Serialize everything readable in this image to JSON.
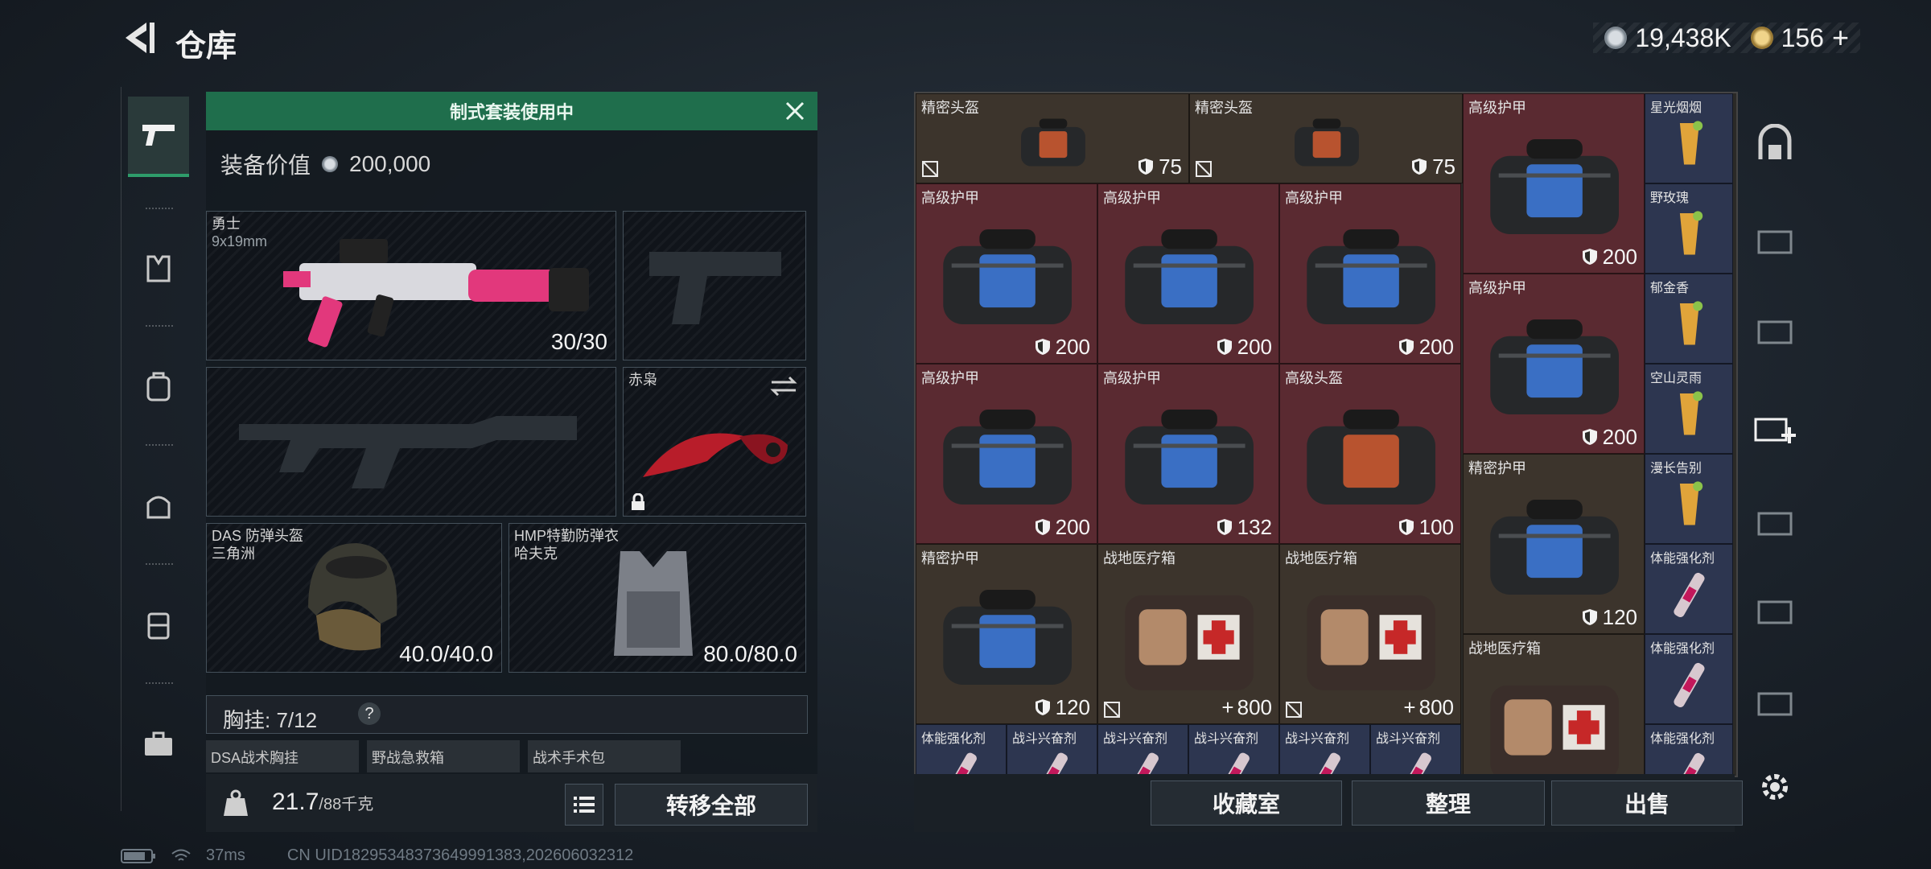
{
  "header": {
    "title": "仓库",
    "coins": "19,438K",
    "tokens": "156",
    "plus": "+"
  },
  "banner": {
    "text": "制式套装使用中"
  },
  "equip": {
    "value_label": "装备价值",
    "value": "200,000"
  },
  "slots": {
    "primary": {
      "name": "勇士",
      "caliber": "9x19mm",
      "count": "30/30"
    },
    "melee": {
      "name": "赤枭"
    },
    "helmet": {
      "name": "DAS 防弹头盔",
      "sub": "三角洲",
      "count": "40.0/40.0"
    },
    "armor": {
      "name": "HMP特勤防弹衣",
      "sub": "哈夫克",
      "count": "80.0/80.0"
    }
  },
  "chest": {
    "label": "胸挂: 7/12",
    "help": "?"
  },
  "chest_items": [
    "DSA战术胸挂",
    "野战急救箱",
    "战术手术包"
  ],
  "bottom": {
    "weight": "21.7",
    "weight_max": "/88千克",
    "transfer_all": "转移全部"
  },
  "grid": {
    "items": [
      {
        "name": "精密头盔",
        "value": "75"
      },
      {
        "name": "精密头盔",
        "value": "75"
      },
      {
        "name": "高级护甲",
        "value": "200"
      },
      {
        "name": "星光烟烟",
        "value": ""
      },
      {
        "name": "高级护甲",
        "value": "200"
      },
      {
        "name": "高级护甲",
        "value": "200"
      },
      {
        "name": "高级护甲",
        "value": "200"
      },
      {
        "name": "野玫瑰",
        "value": ""
      },
      {
        "name": "高级护甲",
        "value": "200"
      },
      {
        "name": "郁金香",
        "value": ""
      },
      {
        "name": "高级护甲",
        "value": "200"
      },
      {
        "name": "高级护甲",
        "value": "132"
      },
      {
        "name": "高级头盔",
        "value": "100"
      },
      {
        "name": "空山灵雨",
        "value": ""
      },
      {
        "name": "精密护甲",
        "value": "120"
      },
      {
        "name": "漫长告别",
        "value": ""
      },
      {
        "name": "精密护甲",
        "value": "120"
      },
      {
        "name": "战地医疗箱",
        "value": "800"
      },
      {
        "name": "战地医疗箱",
        "value": "800"
      },
      {
        "name": "体能强化剂",
        "value": ""
      },
      {
        "name": "战地医疗箱",
        "value": ""
      },
      {
        "name": "体能强化剂",
        "value": ""
      },
      {
        "name": "体能强化剂",
        "value": ""
      },
      {
        "name": "战斗兴奋剂",
        "value": ""
      },
      {
        "name": "战斗兴奋剂",
        "value": ""
      },
      {
        "name": "战斗兴奋剂",
        "value": ""
      },
      {
        "name": "战斗兴奋剂",
        "value": ""
      },
      {
        "name": "战斗兴奋剂",
        "value": ""
      },
      {
        "name": "体能强化剂",
        "value": ""
      }
    ],
    "plus": "+"
  },
  "actions": {
    "vault": "收藏室",
    "sort": "整理",
    "sell": "出售"
  },
  "status": {
    "ping": "37ms",
    "uid": "CN UID182953483736499913​83,202606032312"
  },
  "colors": {
    "accent": "#1f6e4c",
    "armor_bg": "#5a2a31",
    "item_bg": "#3c342c",
    "consumable_bg": "#2d3650"
  }
}
